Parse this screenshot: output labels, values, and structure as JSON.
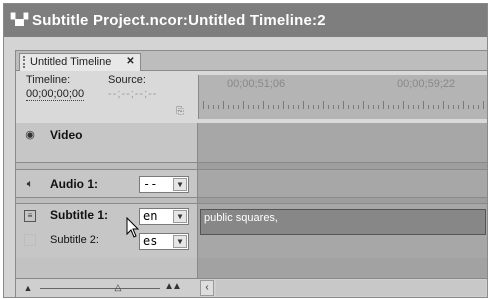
{
  "window": {
    "title": "Subtitle Project.ncor:Untitled Timeline:2",
    "icon": "film-frames-icon"
  },
  "tab": {
    "label": "Untitled Timeline",
    "close_icon": "close-icon"
  },
  "header": {
    "timeline_label": "Timeline:",
    "source_label": "Source:",
    "timeline_timecode": "00;00;00;00",
    "source_timecode": "--;--;--;--",
    "ruler_times": [
      "00;00;51;06",
      "00;00;59;22"
    ]
  },
  "tracks": {
    "video": {
      "name": "Video",
      "icon": "eye-icon"
    },
    "audio1": {
      "name": "Audio 1:",
      "icon": "speaker-icon",
      "language": "--"
    },
    "subtitle1": {
      "name": "Subtitle 1:",
      "icon": "subtitle-track-icon",
      "language": "en",
      "clip_text": "public squares,"
    },
    "subtitle2": {
      "name": "Subtitle 2:",
      "language": "es"
    }
  },
  "footer": {
    "zoom_out_icon": "zoom-out-mountain-icon",
    "zoom_in_icon": "zoom-in-mountain-icon",
    "scroll_left_icon": "chevron-left-icon"
  },
  "colors": {
    "title_bar": "#7e7e7e",
    "track_area": "#a7a7a7",
    "clip": "#878787",
    "ruler": "#b4b4b4"
  }
}
